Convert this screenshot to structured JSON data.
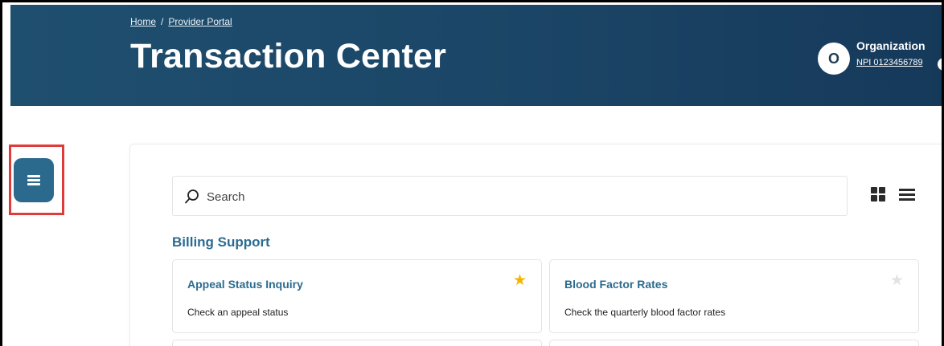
{
  "breadcrumb": {
    "home": "Home",
    "separator": "/",
    "current": "Provider Portal"
  },
  "header": {
    "title": "Transaction Center"
  },
  "organization": {
    "avatar_letter": "O",
    "name": "Organization",
    "npi": "NPI 0123456789",
    "arrow_icon": "chevron-right-icon"
  },
  "sidebar_toggle": {
    "icon": "menu-icon"
  },
  "search": {
    "placeholder": "Search",
    "value": ""
  },
  "view_toggle": {
    "grid_icon": "grid-view-icon",
    "list_icon": "list-view-icon"
  },
  "section": {
    "title": "Billing Support"
  },
  "cards": [
    {
      "title": "Appeal Status Inquiry",
      "description": "Check an appeal status",
      "favorite": true
    },
    {
      "title": "Blood Factor Rates",
      "description": "Check the quarterly blood factor rates",
      "favorite": false
    }
  ],
  "colors": {
    "header": "#1b4566",
    "accent": "#2b6b8f",
    "star_active": "#f4b400",
    "highlight": "#e03b3b"
  }
}
